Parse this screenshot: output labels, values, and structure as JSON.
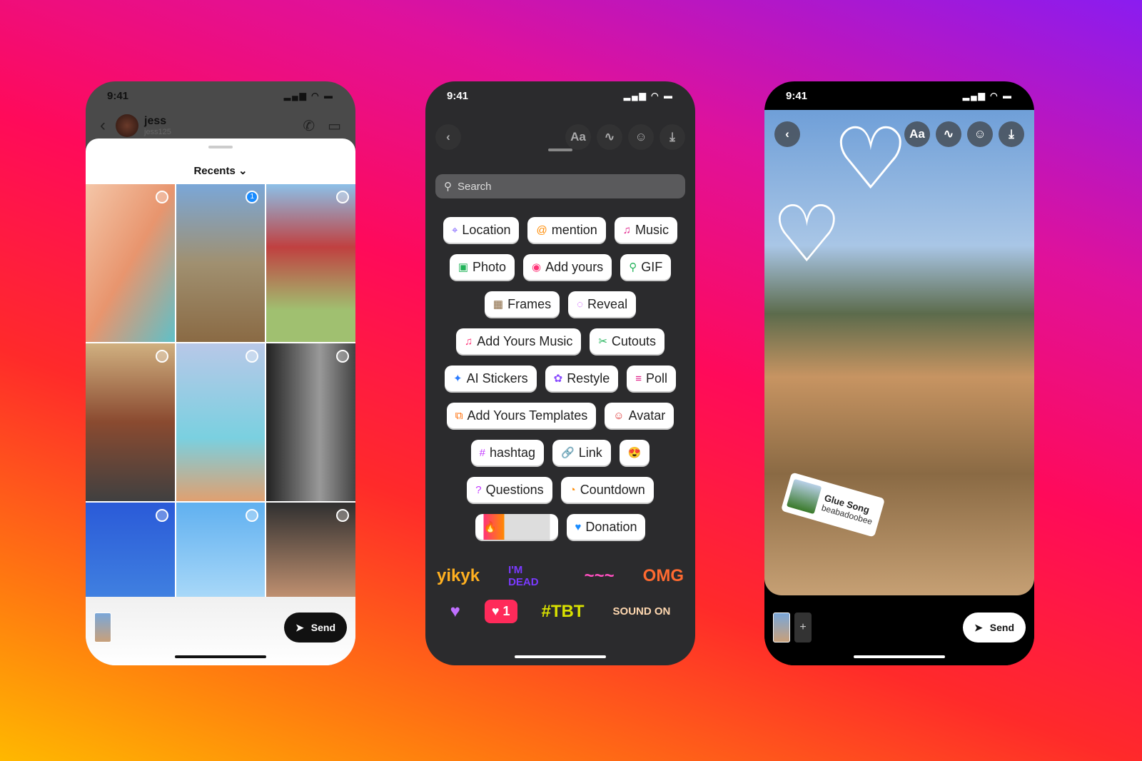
{
  "status_time": "9:41",
  "left": {
    "contact": {
      "name": "jess",
      "handle": "jess125"
    },
    "picker_title": "Recents",
    "selected_count": "1",
    "send_label": "Send"
  },
  "middle": {
    "search_placeholder": "Search",
    "rows": [
      [
        {
          "icon": "location-pin-icon",
          "glyph": "⌖",
          "label": "Location",
          "color": "#7b5cff"
        },
        {
          "icon": "at-icon",
          "glyph": "@",
          "label": "mention",
          "color": "#ff8a00"
        },
        {
          "icon": "music-note-icon",
          "glyph": "♫",
          "label": "Music",
          "color": "#e0218a"
        }
      ],
      [
        {
          "icon": "photo-icon",
          "glyph": "▣",
          "label": "Photo",
          "color": "#22b35a"
        },
        {
          "icon": "camera-icon",
          "glyph": "◉",
          "label": "Add yours",
          "color": "#ff3377"
        },
        {
          "icon": "search-icon",
          "glyph": "⚲",
          "label": "GIF",
          "color": "#22b35a"
        }
      ],
      [
        {
          "icon": "frames-photo-icon",
          "glyph": "▦",
          "label": "Frames",
          "color": "#8a6a44"
        },
        {
          "icon": "eye-off-icon",
          "glyph": "◌",
          "label": "Reveal",
          "color": "#c23aff"
        }
      ],
      [
        {
          "icon": "music-note-icon",
          "glyph": "♫",
          "label": "Add Yours Music",
          "color": "#ff3377"
        },
        {
          "icon": "scissors-icon",
          "glyph": "✂",
          "label": "Cutouts",
          "color": "#22b35a"
        }
      ],
      [
        {
          "icon": "sparkle-icon",
          "glyph": "✦",
          "label": "AI Stickers",
          "color": "#2a7bff"
        },
        {
          "icon": "palette-icon",
          "glyph": "✿",
          "label": "Restyle",
          "color": "#8a4cff"
        },
        {
          "icon": "poll-icon",
          "glyph": "≡",
          "label": "Poll",
          "color": "#e0218a"
        }
      ],
      [
        {
          "icon": "templates-icon",
          "glyph": "⧉",
          "label": "Add Yours Templates",
          "color": "#ff6a00"
        },
        {
          "icon": "avatar-icon",
          "glyph": "☺",
          "label": "Avatar",
          "color": "#d33"
        }
      ],
      [
        {
          "icon": "hashtag-icon",
          "glyph": "#",
          "label": "hashtag",
          "color": "#c23aff"
        },
        {
          "icon": "link-icon",
          "glyph": "🔗",
          "label": "Link",
          "color": "#2a7bff"
        },
        {
          "icon": "heart-eyes-emoji-icon",
          "glyph": "😍",
          "label": "",
          "color": "#ffb800"
        }
      ],
      [
        {
          "icon": "question-icon",
          "glyph": "?",
          "label": "Questions",
          "color": "#c23aff"
        },
        {
          "icon": "countdown-icon",
          "glyph": "◔",
          "label": "Countdown",
          "color": "#ff8a00"
        }
      ],
      [
        {
          "icon": "emoji-slider-icon",
          "glyph": "🔥",
          "label": "",
          "color": "#ff3377"
        },
        {
          "icon": "donation-icon",
          "glyph": "♥",
          "label": "Donation",
          "color": "#1a8cff"
        }
      ]
    ],
    "art_stickers": [
      {
        "name": "yikyk-sticker",
        "text": "yikyk",
        "color": "#ffb020"
      },
      {
        "name": "im-dead-sticker",
        "text": "I'M DEAD",
        "color": "#7a3aff"
      },
      {
        "name": "graffiti-sticker",
        "text": "~~~",
        "color": "#ff4fc0"
      },
      {
        "name": "omg-sticker",
        "text": "OMG",
        "color": "#ff6a30"
      },
      {
        "name": "heart-face-sticker",
        "text": "♥",
        "color": "#c070ff"
      },
      {
        "name": "like-count-sticker",
        "text": "♥ 1",
        "color": "#ff2a5a"
      },
      {
        "name": "tbt-sticker",
        "text": "#TBT",
        "color": "#d8e000"
      },
      {
        "name": "sound-on-sticker",
        "text": "SOUND ON",
        "color": "#ffd8b0"
      }
    ]
  },
  "right": {
    "music_sticker": {
      "title": "Glue Song",
      "artist": "beabadoobee"
    },
    "send_label": "Send"
  }
}
